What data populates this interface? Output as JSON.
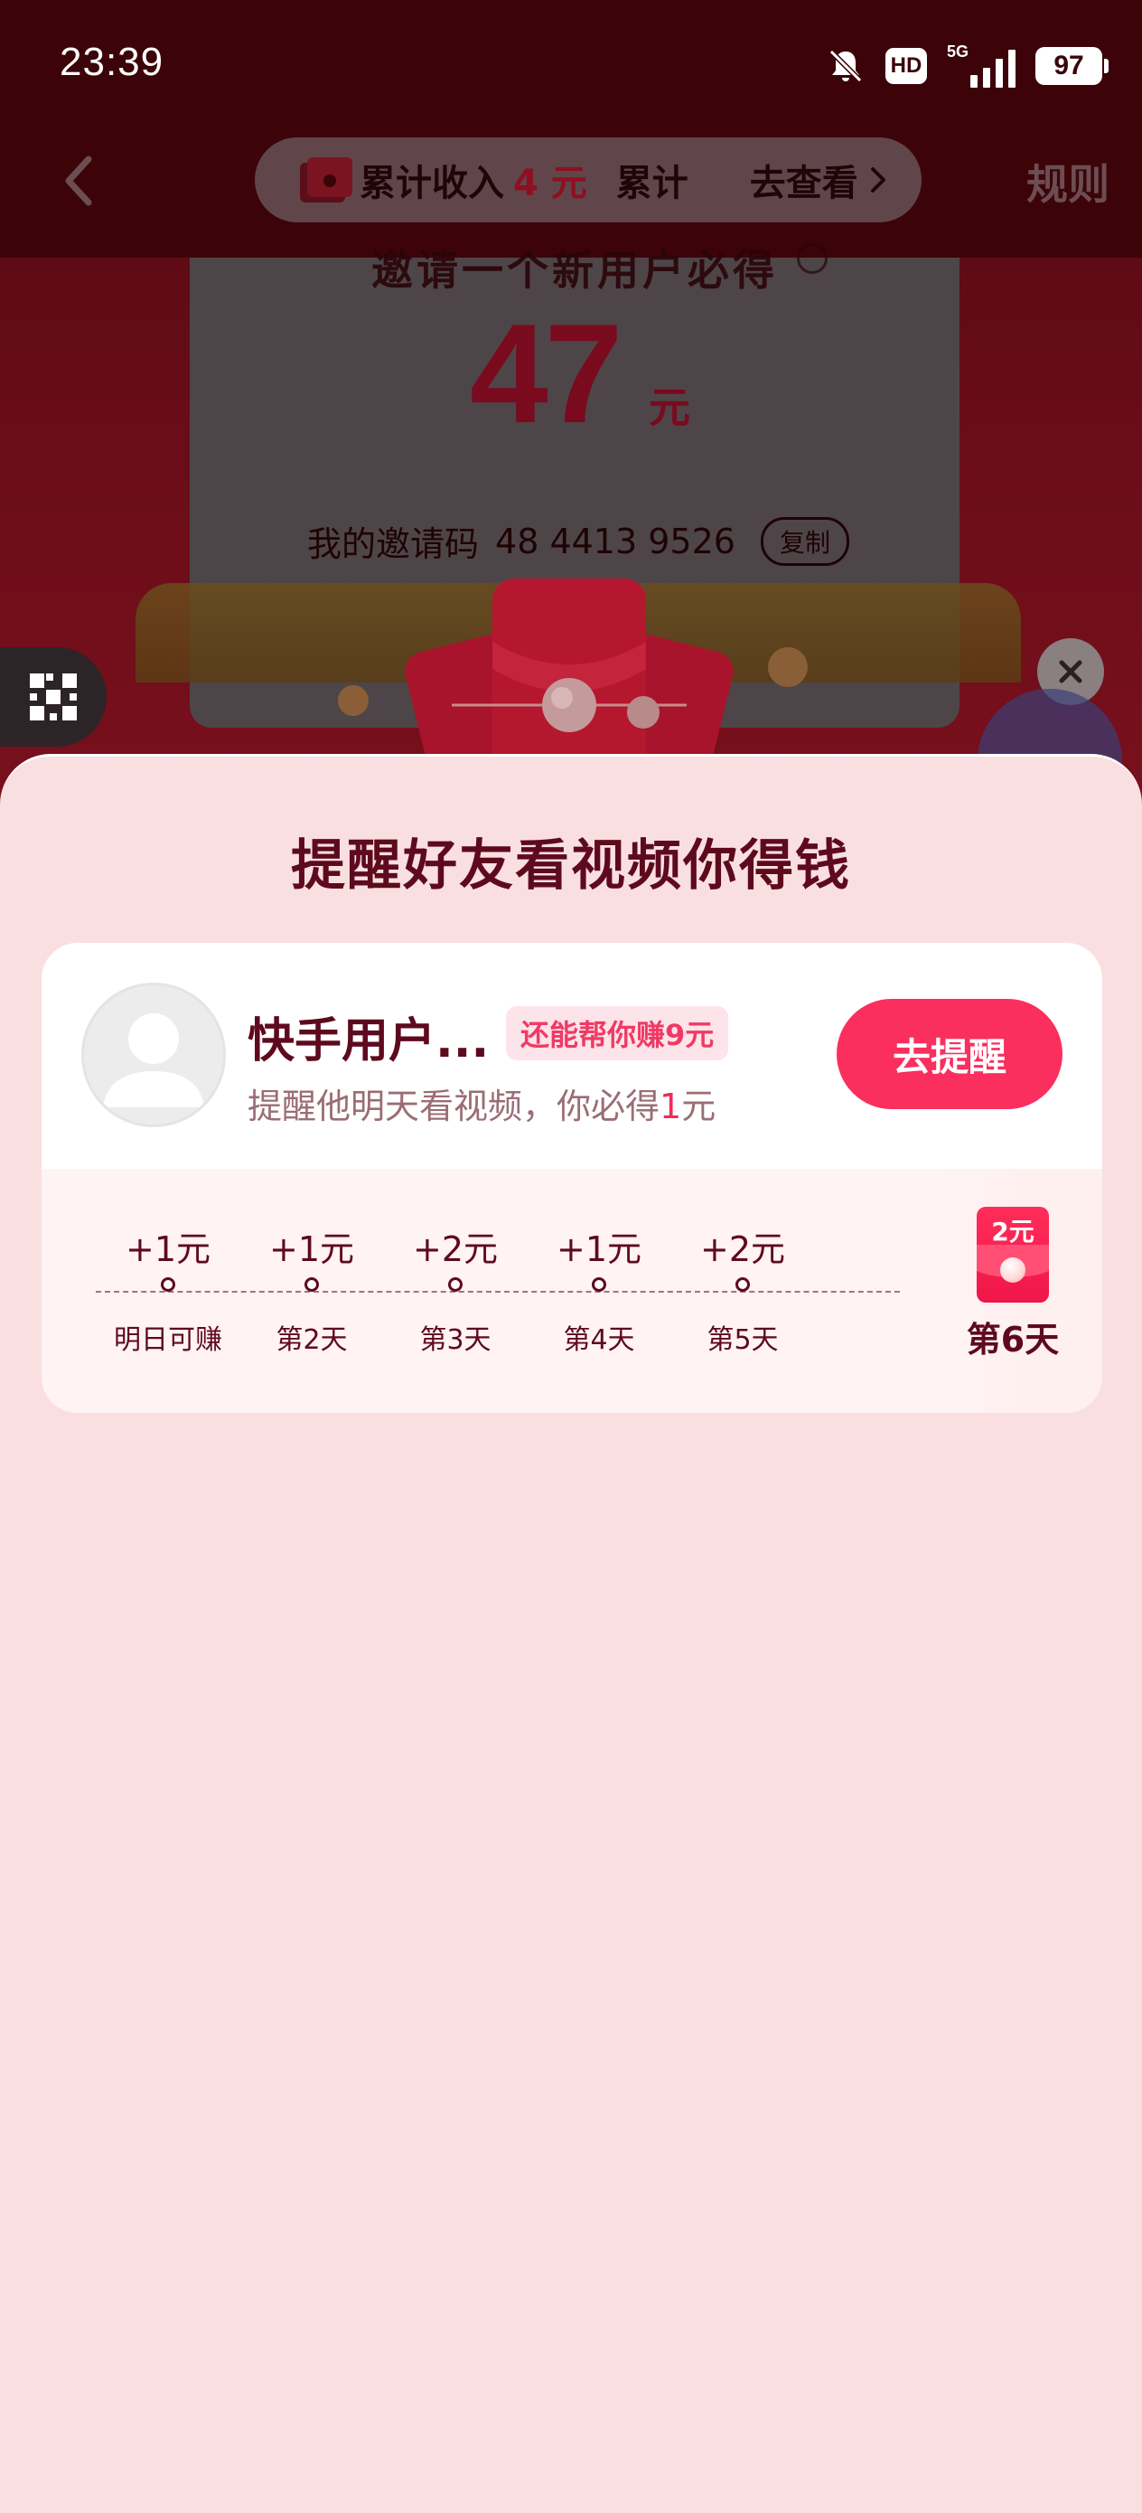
{
  "status_bar": {
    "time": "23:39",
    "hd": "HD",
    "network": "5G",
    "battery": "97"
  },
  "header": {
    "income_prefix": "累计收入",
    "income_amount": "4 元",
    "income_suffix": "累计",
    "view_label": "去查看",
    "rules_label": "规则"
  },
  "invite_card": {
    "title": "邀请一个新用户必得",
    "amount": "47",
    "unit": "元",
    "code_label": "我的邀请码",
    "code_value": "48 4413 9526",
    "copy_label": "复制"
  },
  "sheet": {
    "title": "提醒好友看视频你得钱",
    "friend": {
      "name": "快手用户...",
      "earn_badge": "还能帮你赚9元",
      "subtitle_prefix": "提醒他明天看视频，你必得",
      "subtitle_amount": "1",
      "subtitle_unit": "元",
      "remind_button": "去提醒"
    },
    "steps": [
      {
        "reward": "+1元",
        "label": "明日可赚"
      },
      {
        "reward": "+1元",
        "label": "第2天"
      },
      {
        "reward": "+2元",
        "label": "第3天"
      },
      {
        "reward": "+1元",
        "label": "第4天"
      },
      {
        "reward": "+2元",
        "label": "第5天"
      }
    ],
    "final_step": {
      "reward": "2元",
      "label": "第6天"
    }
  },
  "colors": {
    "accent": "#fa2f5e",
    "title": "#5e0a1e",
    "sheet_bg": "#f9dfe0"
  }
}
